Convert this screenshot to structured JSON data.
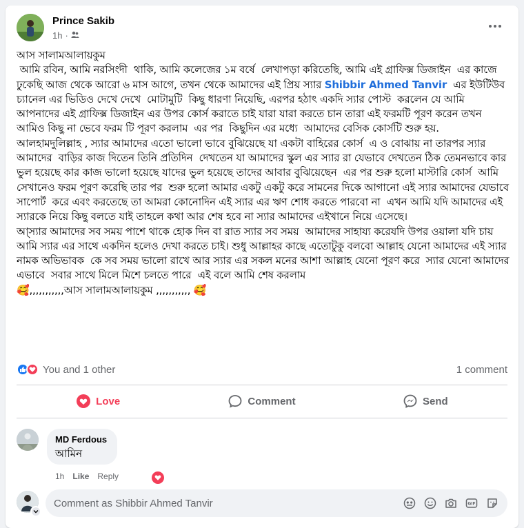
{
  "post": {
    "author": "Prince Sakib",
    "time": "1h",
    "privacy_icon": "friends-icon",
    "text_1": "আস সালামআলায়কুম\n আমি রবিন, আমি নরসিংদী  থাকি, আমি কলেজের ১ম বর্ষে  লেখাপড়া করিতেছি, আমি এই গ্রাফিক্স ডিজাইন  এর কাজে ঢুকেছি আজ থেকে আরো ৬ মাস আগে, তখন থেকে আমাদের এই প্রিয় স্যার ",
    "mention": "Shibbir Ahmed Tanvir",
    "text_2": "  এর ইউটিউব চ্যানেল এর ভিডিও দেখে দেখে  মোটামুটি  কিছু ধারণা নিয়েছি, এরপর হঠাৎ একদি স্যার পোস্ট  করলেন যে আমি আপনাদের এই গ্রাফিক্স ডিজাইন এর উপর কোর্স করাতে চাই যারা যারা করতে চান তারা এই ফরমটি পূরণ করেন তখন আমিও কিছু না ভেবে ফরম টি পূরণ করলাম  এর পর  কিছুদিন এর মধ্যে  আমাদের বেসিক কোর্সটি শুরু হয়.\nআলহামদুলিল্লাহ , স্যার আমাদের এতো ভালো ভাবে বুঝিয়েছে যা একটা বাহিরের কোর্স  এ ও বোঝায় না তারপর স্যার আমাদের  বাড়ির কাজ দিতেন তিনি প্রতিদিন  দেখতেন যা আমাদের স্কুল এর স্যার রা যেভাবে দেখতেন ঠিক তেমনভাবে কার ভুল হয়েছে কার কাজ ভালো হয়েছে যাদের ভুল হয়েছে তাদের আবার বুঝিয়েছেন  এর পর শুরু হলো মাস্টারি কোর্স  আমি সেখানেও ফরম পূরণ করেছি তার পর  শুরু হলো আমার একটু একটু করে সামনের দিকে আগানো এই স্যার আমাদের যেভাবে সাপোর্ট  করে এবং করতেছে তা আমরা কোনোদিন এই স্যার এর ঋণ শোধ করতে পারবো না  এখন আমি যদি আমাদের এই স্যারকে নিয়ে কিছু বলতে যাই তাহলে কথা আর শেষ হবে না স্যার আমাদের এইখানে নিয়ে এসেছে।\nআ্স্যার আমাদের সব সময় পাশে থাকে হোক দিন বা রাত স্যার সব সময়  আমাদের সাহায্য করেযদি উপর ওয়ালা যদি চায়  আমি স্যার এর সাথে একদিন হলেও দেখা করতে চাই। শুধু আল্লাহর কাছে এতোটুকু বলবো আল্লাহ যেনো আমাদের এই স্যার নামক অভিভাবক  কে সব সময় ভালো রাখে আর স্যার এর সকল মনের আশা আল্লাহ যেনো পূরণ করে  স্যার যেনো আমাদের এভাবে  সবার সাথে মিলে মিশে চলতে পারে  এই বলে আমি শেষ করলাম\n🥰,,,,,,,,,,,আস সালামআলায়কুম ,,,,,,,,,,, 🥰"
  },
  "reactions": {
    "summary": "You and 1 other",
    "comment_count": "1 comment"
  },
  "actions": {
    "love": "Love",
    "comment": "Comment",
    "send": "Send"
  },
  "comment": {
    "author": "MD Ferdous",
    "text": "আমিন",
    "time": "1h",
    "like": "Like",
    "reply": "Reply"
  },
  "composer": {
    "placeholder": "Comment as Shibbir Ahmed Tanvir"
  },
  "colors": {
    "like_blue": "#1877f2",
    "love_red": "#f33e58",
    "mention_blue": "#216fdb"
  }
}
